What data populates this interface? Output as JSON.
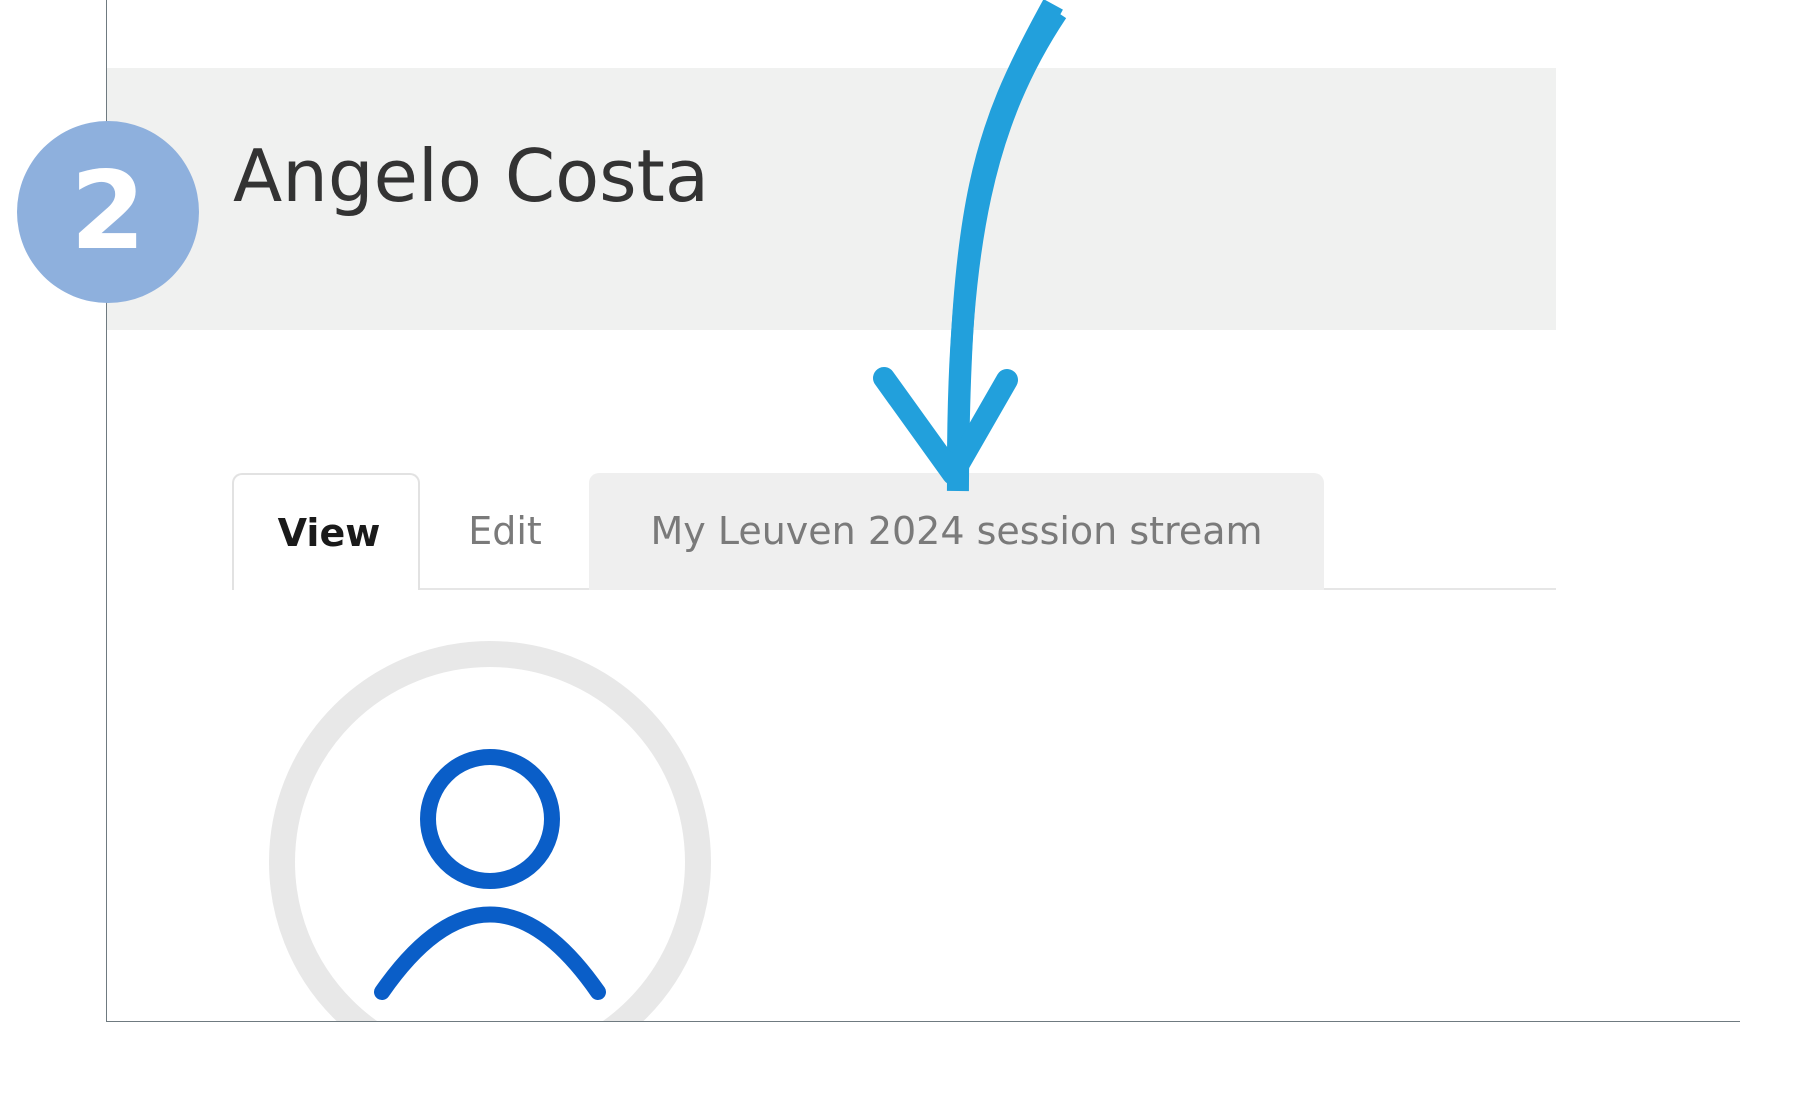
{
  "header": {
    "title": "Angelo Costa"
  },
  "badge": {
    "number": "2",
    "color": "#8eb0dd"
  },
  "tabs": [
    {
      "label": "View",
      "active": true
    },
    {
      "label": "Edit",
      "active": false
    },
    {
      "label": "My Leuven 2024 session stream",
      "active": false,
      "highlighted": true
    }
  ],
  "avatar": {
    "icon": "user-icon",
    "icon_color": "#0a5ec8",
    "ring_color": "#e8e8e8"
  },
  "annotation": {
    "icon": "arrow-down-icon",
    "color": "#22a0dc"
  }
}
